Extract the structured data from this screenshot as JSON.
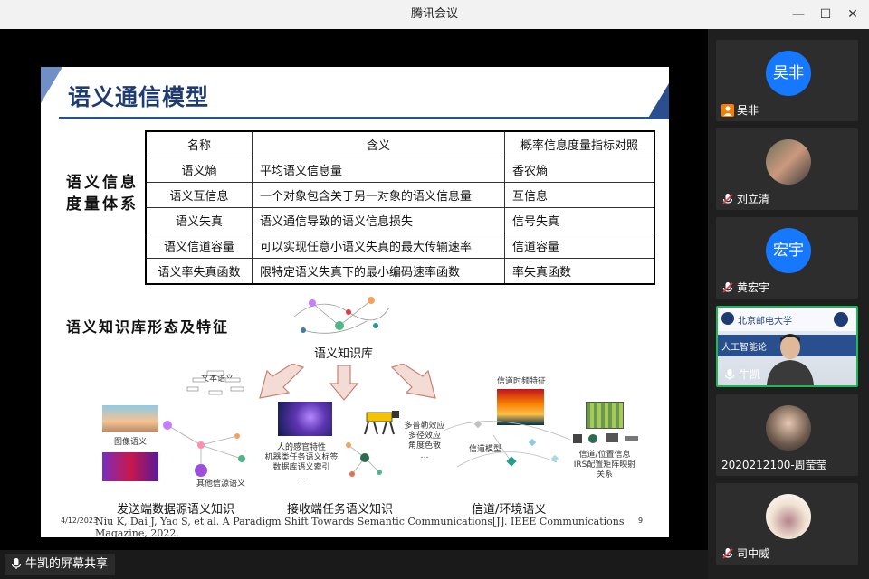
{
  "window": {
    "title": "腾讯会议",
    "minimize_glyph": "—",
    "maximize_glyph": "☐",
    "close_glyph": "✕"
  },
  "slide": {
    "title": "语义通信模型",
    "left_label_line1": "语义信息",
    "left_label_line2": "度量体系",
    "table": {
      "headers": [
        "名称",
        "含义",
        "概率信息度量指标对照"
      ],
      "rows": [
        [
          "语义熵",
          "平均语义信息量",
          "香农熵"
        ],
        [
          "语义互信息",
          "一个对象包含关于另一对象的语义信息量",
          "互信息"
        ],
        [
          "语义失真",
          "语义通信导致的语义信息损失",
          "信号失真"
        ],
        [
          "语义信道容量",
          "可以实现任意小语义失真的最大传输速率",
          "信道容量"
        ],
        [
          "语义率失真函数",
          "限特定语义失真下的最小编码速率函数",
          "率失真函数"
        ]
      ]
    },
    "kb_section_title": "语义知识库形态及特征",
    "kb_label": "语义知识库",
    "left_cluster": {
      "text_semantic": "文本语义",
      "image_semantic": "图像语义",
      "other_semantic": "其他信源语义"
    },
    "middle_cluster": {
      "line1": "人的感官特性",
      "line2": "机器类任务语义标签",
      "line3": "数据库语义索引",
      "dots": "…"
    },
    "right_cluster": {
      "timefreq": "信道时频特征",
      "multipath1": "多普勒效应",
      "multipath2": "多径效应",
      "multipath3": "角度色散",
      "dots": "…",
      "model": "信道模型",
      "info1": "信道/位置信息",
      "info2": "IRS配置矩阵映射",
      "info3": "关系"
    },
    "captions": [
      "发送端数据源语义知识",
      "接收端任务语义知识",
      "信道/环境语义"
    ],
    "reference": "Niu K, Dai J, Yao S, et al. A Paradigm Shift Towards Semantic Communications[J]. IEEE Communications Magazine, 2022.",
    "date": "4/12/2023",
    "page_number": "9"
  },
  "share_label": "牛凯的屏幕共享",
  "participants": [
    {
      "name": "吴非",
      "avatar_text": "吴非",
      "type": "initials"
    },
    {
      "name": "刘立清",
      "type": "photo"
    },
    {
      "name": "黄宏宇",
      "avatar_text": "宏宇",
      "type": "initials"
    },
    {
      "name": "牛凯",
      "type": "video",
      "banner_text": "北京邮电大学",
      "overlay_text": "人工智能论"
    },
    {
      "name": "2020212100-周莹莹",
      "type": "photo"
    },
    {
      "name": "司中威",
      "type": "photo"
    }
  ],
  "colors": {
    "accent": "#1677ff",
    "active_border": "#1db954",
    "slide_title": "#1f3b73"
  }
}
